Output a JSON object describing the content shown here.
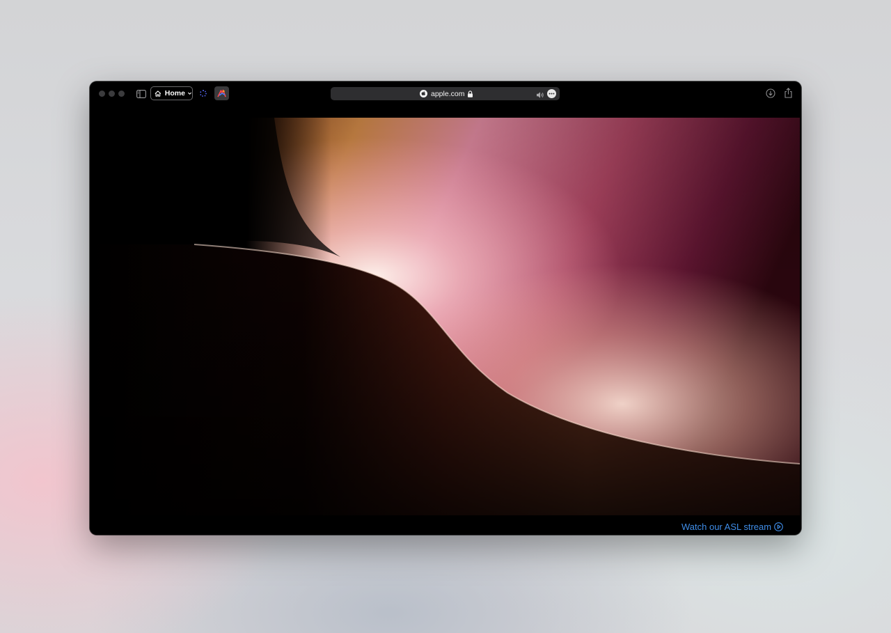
{
  "browser": {
    "profile_label": "Home",
    "address": "apple.com",
    "icons": {
      "sidebar": "sidebar-icon",
      "home": "house-icon",
      "chevron": "chevron-down-icon",
      "spark": "loading-spinner-icon",
      "extension": "extension-icon",
      "favicon": "apple-favicon-icon",
      "lock": "lock-icon",
      "audio": "speaker-icon",
      "more": "ellipsis-circle-icon",
      "download": "download-icon",
      "share": "share-icon"
    }
  },
  "page": {
    "asl_link": "Watch our ASL stream",
    "asl_icon": "play-circle-icon",
    "link_color": "#3f8de8"
  }
}
